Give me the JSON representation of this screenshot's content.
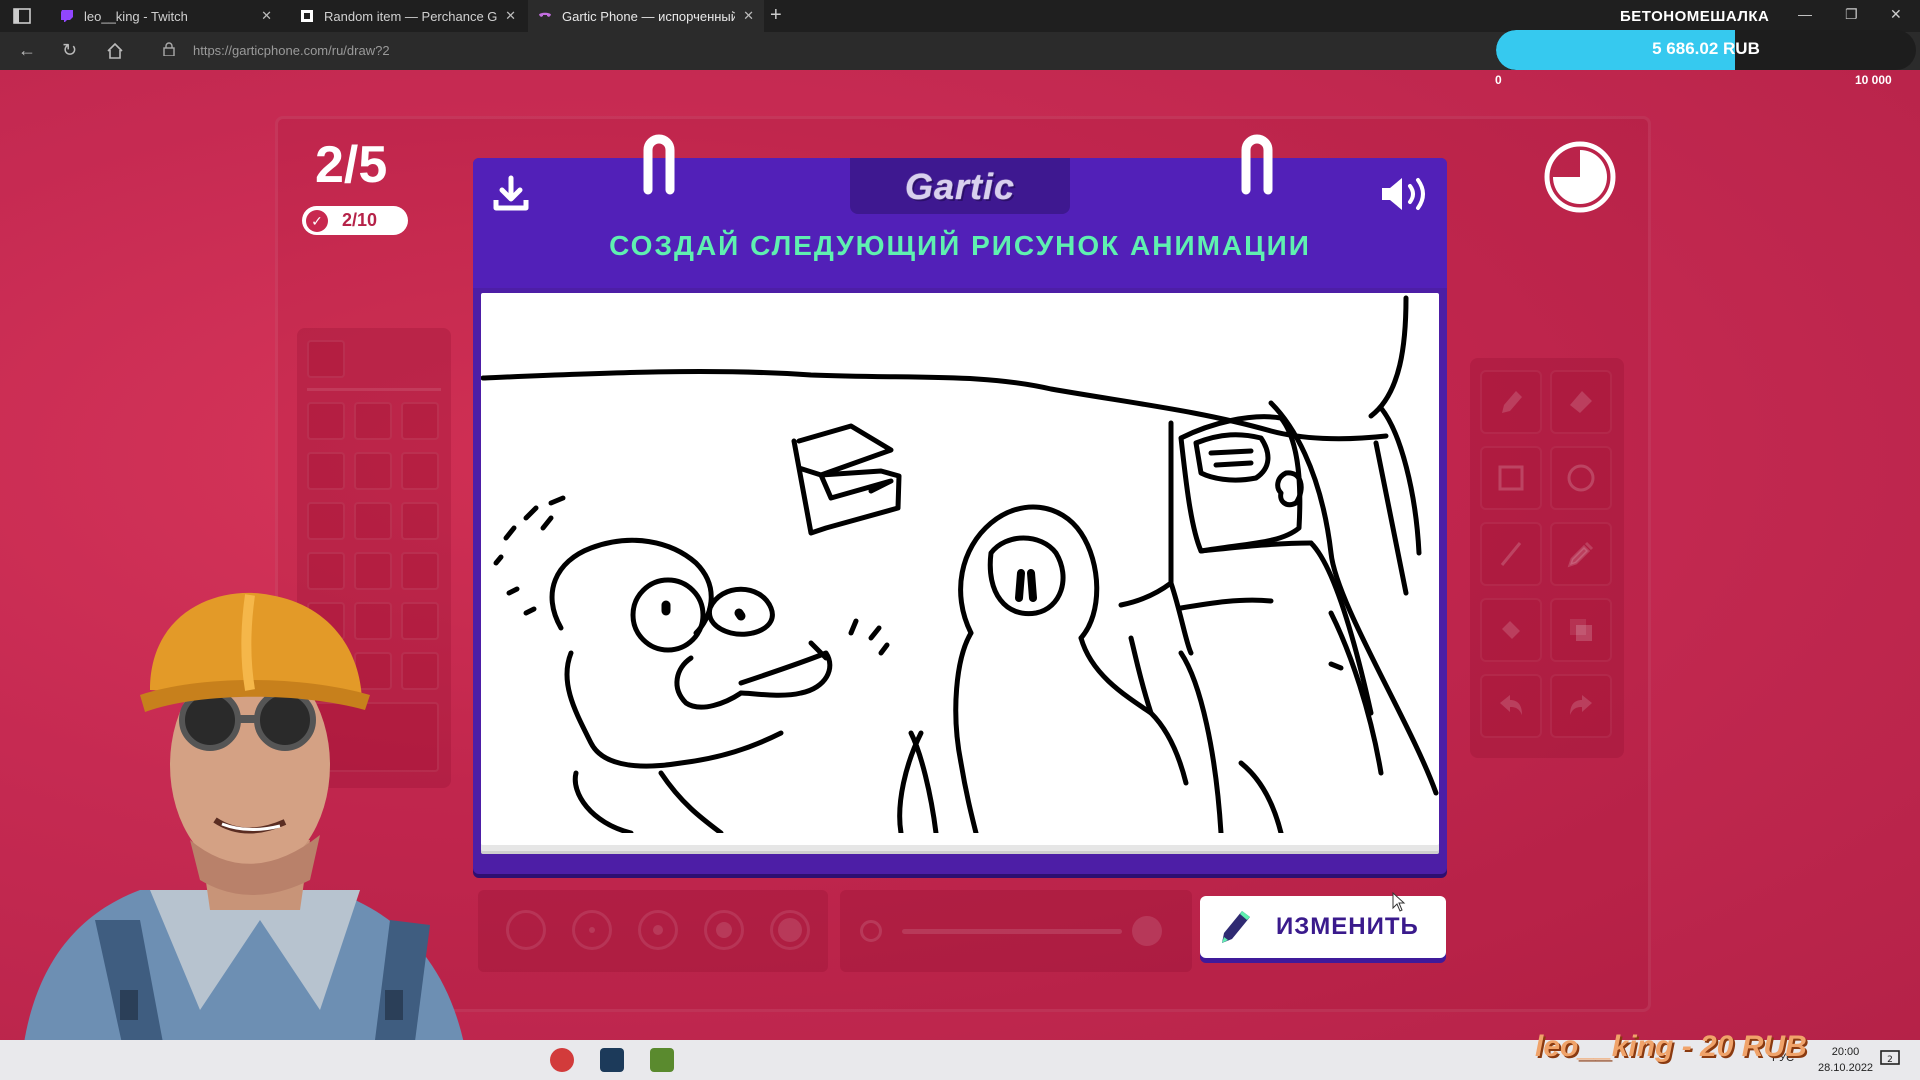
{
  "browser": {
    "tabs": [
      {
        "title": "leo__king - Twitch",
        "favicon": "twitch-icon",
        "active": false
      },
      {
        "title": "Random item — Perchance Generator",
        "favicon": "perchance-icon",
        "active": false
      },
      {
        "title": "Gartic Phone — испорченный телефон",
        "favicon": "gartic-phone-icon",
        "active": true
      }
    ],
    "close_glyph": "✕",
    "new_tab_glyph": "+",
    "window_title": "БЕТОНОМЕШАЛКА",
    "url": "https://garticphone.com/ru/draw?2"
  },
  "donation_goal": {
    "value_text": "5 686.02 RUB",
    "min_text": "0",
    "max_text": "10 000",
    "progress": 0.5686,
    "color": "#36c9ef"
  },
  "game": {
    "round_counter": "2/5",
    "players_done": "2/10",
    "logo": "Gartic",
    "instruction": "СОЗДАЙ СЛЕДУЮЩИЙ РИСУНОК АНИМАЦИИ",
    "change_button_label": "ИЗМЕНИТЬ",
    "accent_colors": {
      "header": "#5220b8",
      "instruction": "#5ff0b0",
      "background": "#c8284f"
    },
    "tools": [
      "pencil-icon",
      "eraser-icon",
      "rectangle-icon",
      "ellipse-icon",
      "line-icon",
      "eyedropper-icon",
      "fill-icon",
      "layers-icon",
      "undo-icon",
      "redo-icon"
    ]
  },
  "overlay": {
    "donor_ticker": "leo__king - 20 RUB"
  },
  "taskbar": {
    "language": "РУС",
    "time": "20:00",
    "date": "28.10.2022",
    "notifications": "2"
  }
}
